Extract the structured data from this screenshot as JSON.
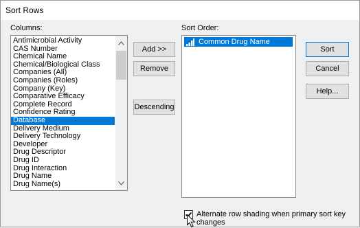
{
  "window": {
    "title": "Sort Rows"
  },
  "columns": {
    "label": "Columns:",
    "items": [
      "Antimicrobial Activity",
      "CAS Number",
      "Chemical Name",
      "Chemical/Biological Class",
      "Companies (All)",
      "Companies (Roles)",
      "Company (Key)",
      "Comparative Efficacy",
      "Complete Record",
      "Confidence Rating",
      "Database",
      "Delivery Medium",
      "Delivery Technology",
      "Developer",
      "Drug Descriptor",
      "Drug ID",
      "Drug Interaction",
      "Drug Name",
      "Drug Name(s)"
    ],
    "selected": "Database"
  },
  "middle_buttons": {
    "add": "Add >>",
    "remove": "Remove",
    "descending": "Descending"
  },
  "sort_order": {
    "label": "Sort Order:",
    "items": [
      {
        "label": "Common Drug Name",
        "icon": "ascending-sort-icon"
      }
    ]
  },
  "right_buttons": {
    "sort": "Sort",
    "cancel": "Cancel",
    "help": "Help..."
  },
  "option": {
    "label": "Alternate row shading when primary sort key changes",
    "checked": true
  },
  "colors": {
    "selection": "#0078d7",
    "dialog_bg": "#f0f0f0",
    "button_bg": "#e1e1e1"
  }
}
